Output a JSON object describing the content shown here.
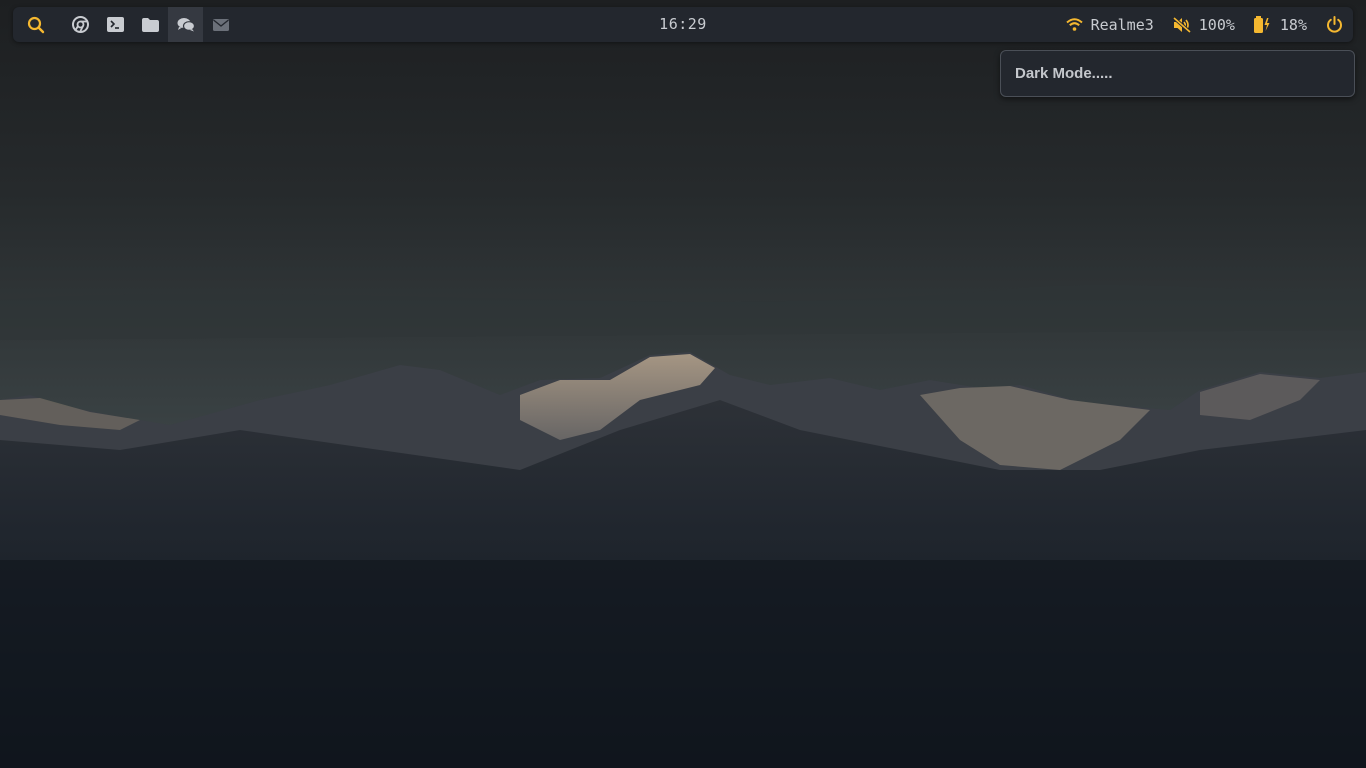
{
  "colors": {
    "accent": "#f5b830",
    "bar_bg": "#23272e",
    "icon_default": "#c9ccd1",
    "icon_dim": "#6b7079",
    "text": "#c9ccd1"
  },
  "topbar": {
    "launchers": [
      {
        "icon": "search-icon",
        "active": false
      },
      {
        "icon": "chrome-icon",
        "active": false
      },
      {
        "icon": "terminal-icon",
        "active": false
      },
      {
        "icon": "folder-icon",
        "active": false
      },
      {
        "icon": "chat-icon",
        "active": true
      },
      {
        "icon": "mail-icon",
        "active": false
      }
    ],
    "clock": "16:29",
    "wifi": {
      "icon": "wifi-icon",
      "label": "Realme3"
    },
    "volume": {
      "icon": "volume-muted-icon",
      "label": "100%"
    },
    "battery": {
      "icon": "battery-charging-icon",
      "label": "18%"
    },
    "power": {
      "icon": "power-icon"
    }
  },
  "popup": {
    "text": "Dark Mode....."
  },
  "wallpaper": {
    "subject": "mountain-range-at-dusk"
  }
}
